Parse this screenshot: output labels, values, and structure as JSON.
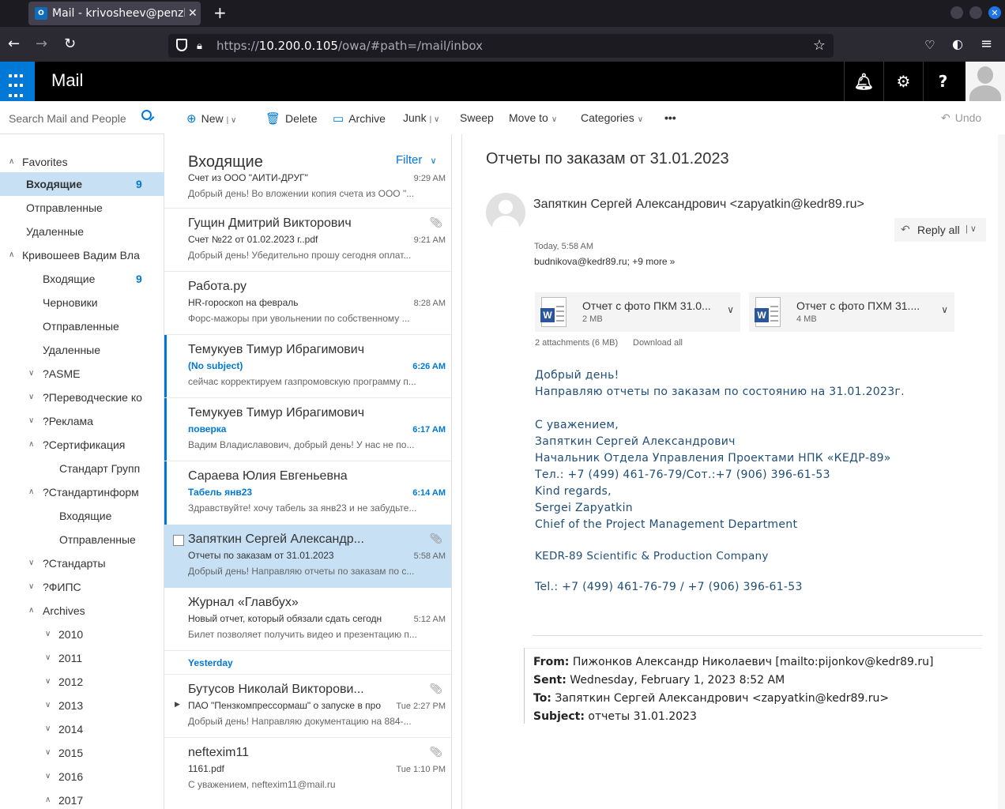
{
  "browser": {
    "tab_title": "Mail - krivosheev@penzh",
    "tab_favicon": "O",
    "url_host_prefix": "https://",
    "url_host": "10.200.0.105",
    "url_path": "/owa/#path=/mail/inbox"
  },
  "header": {
    "app_title": "Mail"
  },
  "search": {
    "placeholder": "Search Mail and People"
  },
  "toolbar": {
    "new": "New",
    "delete": "Delete",
    "archive": "Archive",
    "junk": "Junk",
    "sweep": "Sweep",
    "move_to": "Move to",
    "categories": "Categories",
    "more": "•••",
    "undo": "Undo"
  },
  "nav": {
    "favorites": "Favorites",
    "fav_inbox": "Входящие",
    "fav_inbox_count": "9",
    "fav_sent": "Отправленные",
    "fav_deleted": "Удаленные",
    "account": "Кривошеев Вадим Вла",
    "inbox": "Входящие",
    "inbox_count": "9",
    "drafts": "Черновики",
    "sent": "Отправленные",
    "deleted": "Удаленные",
    "asme": "?ASME",
    "translation": "?Переводческие ко",
    "ads": "?Реклама",
    "certification": "?Сертификация",
    "standard_group": "Стандарт Групп",
    "standartinform": "?Стандартинформ",
    "si_inbox": "Входящие",
    "si_sent": "Отправленные",
    "standards": "?Стандарты",
    "fips": "?ФИПС",
    "archives": "Archives",
    "y2010": "2010",
    "y2011": "2011",
    "y2012": "2012",
    "y2013": "2013",
    "y2014": "2014",
    "y2015": "2015",
    "y2016": "2016",
    "y2017": "2017"
  },
  "list": {
    "title": "Входящие",
    "filter": "Filter",
    "yesterday": "Yesterday",
    "messages": [
      {
        "sender": "",
        "subject": "Счет из ООО \"АИТИ-ДРУГ\"",
        "preview": "Добрый день!  Во вложении копия счета из ООО \"...",
        "time": "9:29 AM"
      },
      {
        "sender": "Гущин Дмитрий Викторович",
        "subject": "Счет №22 от 01.02.2023 г..pdf",
        "preview": "Добрый день!  Убедительно прошу сегодня оплат...",
        "time": "9:21 AM"
      },
      {
        "sender": "Работа.ру",
        "subject": "HR-гороскоп на февраль",
        "preview": "Форс-мажоры при увольнении по собственному     ...",
        "time": "8:28 AM"
      },
      {
        "sender": "Темукуев Тимур Ибрагимович",
        "subject": "(No subject)",
        "preview": "сейчас корректируем газпромовскую программу п...",
        "time": "6:26 AM"
      },
      {
        "sender": "Темукуев Тимур Ибрагимович",
        "subject": "поверка",
        "preview": "Вадим Владиславович, добрый день! У нас не по...",
        "time": "6:17 AM"
      },
      {
        "sender": "Сараева Юлия Евгеньевна",
        "subject": "Табель янв23",
        "preview": "Здравствуйте! хочу табель за янв23 и не забудьте...",
        "time": "6:14 AM"
      },
      {
        "sender": "Запяткин Сергей Александр...",
        "subject": "Отчеты по заказам от 31.01.2023",
        "preview": "Добрый день! Направляю отчеты по заказам по с...",
        "time": "5:58 AM"
      },
      {
        "sender": "Журнал «Главбух»",
        "subject": "Новый отчет, который обязали сдать сегодн",
        "preview": "Билет позволяет получить видео и презентацию п...",
        "time": "5:12 AM"
      },
      {
        "sender": "Бутусов Николай Викторови...",
        "subject": "ПАО \"Пензкомпрессормаш\" о запуске в про",
        "preview": "Добрый день!  Направляю документацию на 884-...",
        "time": "Tue 2:27 PM"
      },
      {
        "sender": "neftexim11",
        "subject": "1161.pdf",
        "preview": "С уважением, neftexim11@mail.ru",
        "time": "Tue 1:10 PM"
      }
    ]
  },
  "reading": {
    "subject": "Отчеты по заказам от 31.01.2023",
    "from": "Запяткин Сергей Александрович <zapyatkin@kedr89.ru>",
    "reply_all": "Reply all",
    "date": "Today, 5:58 AM",
    "to": "budnikova@kedr89.ru; +9 more",
    "attachments": [
      {
        "name": "Отчет с фото ПКМ 31.0...",
        "size": "2 MB"
      },
      {
        "name": "Отчет с фото ПХМ 31....",
        "size": "4 MB"
      }
    ],
    "att_summary": "2 attachments (6 MB)",
    "download_all": "Download all",
    "body": [
      "Добрый день!",
      "Направляю отчеты по заказам по состоянию на 31.01.2023г.",
      "С уважением,",
      "Запяткин Сергей Александрович",
      "Начальник Отдела Управления Проектами НПК «КЕДР-89»",
      "Тел.: +7 (499) 461-76-79/Сот.:+7 (906) 396-61-53",
      "Kind regards,",
      "Sergei Zapyatkin",
      "Chief of the Project Management Department",
      "KEDR-89 Scientific & Production Company",
      "Tel.: +7 (499) 461-76-79 / +7 (906) 396-61-53"
    ],
    "fwd": {
      "from_label": "From:",
      "from": "Пижонков Александр Николаевич [mailto:pijonkov@kedr89.ru]",
      "sent_label": "Sent:",
      "sent": "Wednesday, February 1, 2023 8:52 AM",
      "to_label": "To:",
      "to": "Запяткин Сергей Александрович <zapyatkin@kedr89.ru>",
      "subject_label": "Subject:",
      "subject": "отчеты 31.01.2023"
    }
  }
}
